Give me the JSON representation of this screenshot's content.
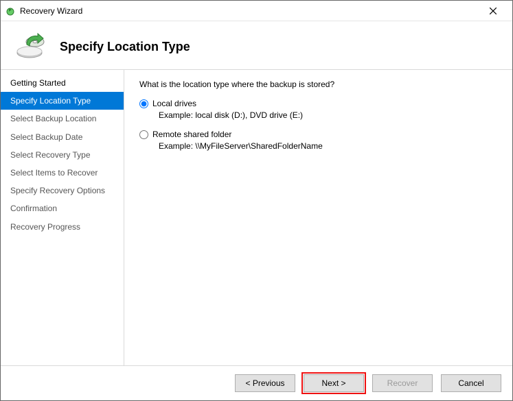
{
  "title": "Recovery Wizard",
  "header": {
    "heading": "Specify Location Type"
  },
  "sidebar": {
    "steps": [
      {
        "label": "Getting Started",
        "state": "done"
      },
      {
        "label": "Specify Location Type",
        "state": "active"
      },
      {
        "label": "Select Backup Location",
        "state": "pending"
      },
      {
        "label": "Select Backup Date",
        "state": "pending"
      },
      {
        "label": "Select Recovery Type",
        "state": "pending"
      },
      {
        "label": "Select Items to Recover",
        "state": "pending"
      },
      {
        "label": "Specify Recovery Options",
        "state": "pending"
      },
      {
        "label": "Confirmation",
        "state": "pending"
      },
      {
        "label": "Recovery Progress",
        "state": "pending"
      }
    ]
  },
  "content": {
    "prompt": "What is the location type where the backup is stored?",
    "options": [
      {
        "label": "Local drives",
        "example": "Example: local disk (D:), DVD drive (E:)",
        "selected": true
      },
      {
        "label": "Remote shared folder",
        "example": "Example: \\\\MyFileServer\\SharedFolderName",
        "selected": false
      }
    ]
  },
  "buttons": {
    "previous": "< Previous",
    "next": "Next >",
    "recover": "Recover",
    "cancel": "Cancel"
  }
}
